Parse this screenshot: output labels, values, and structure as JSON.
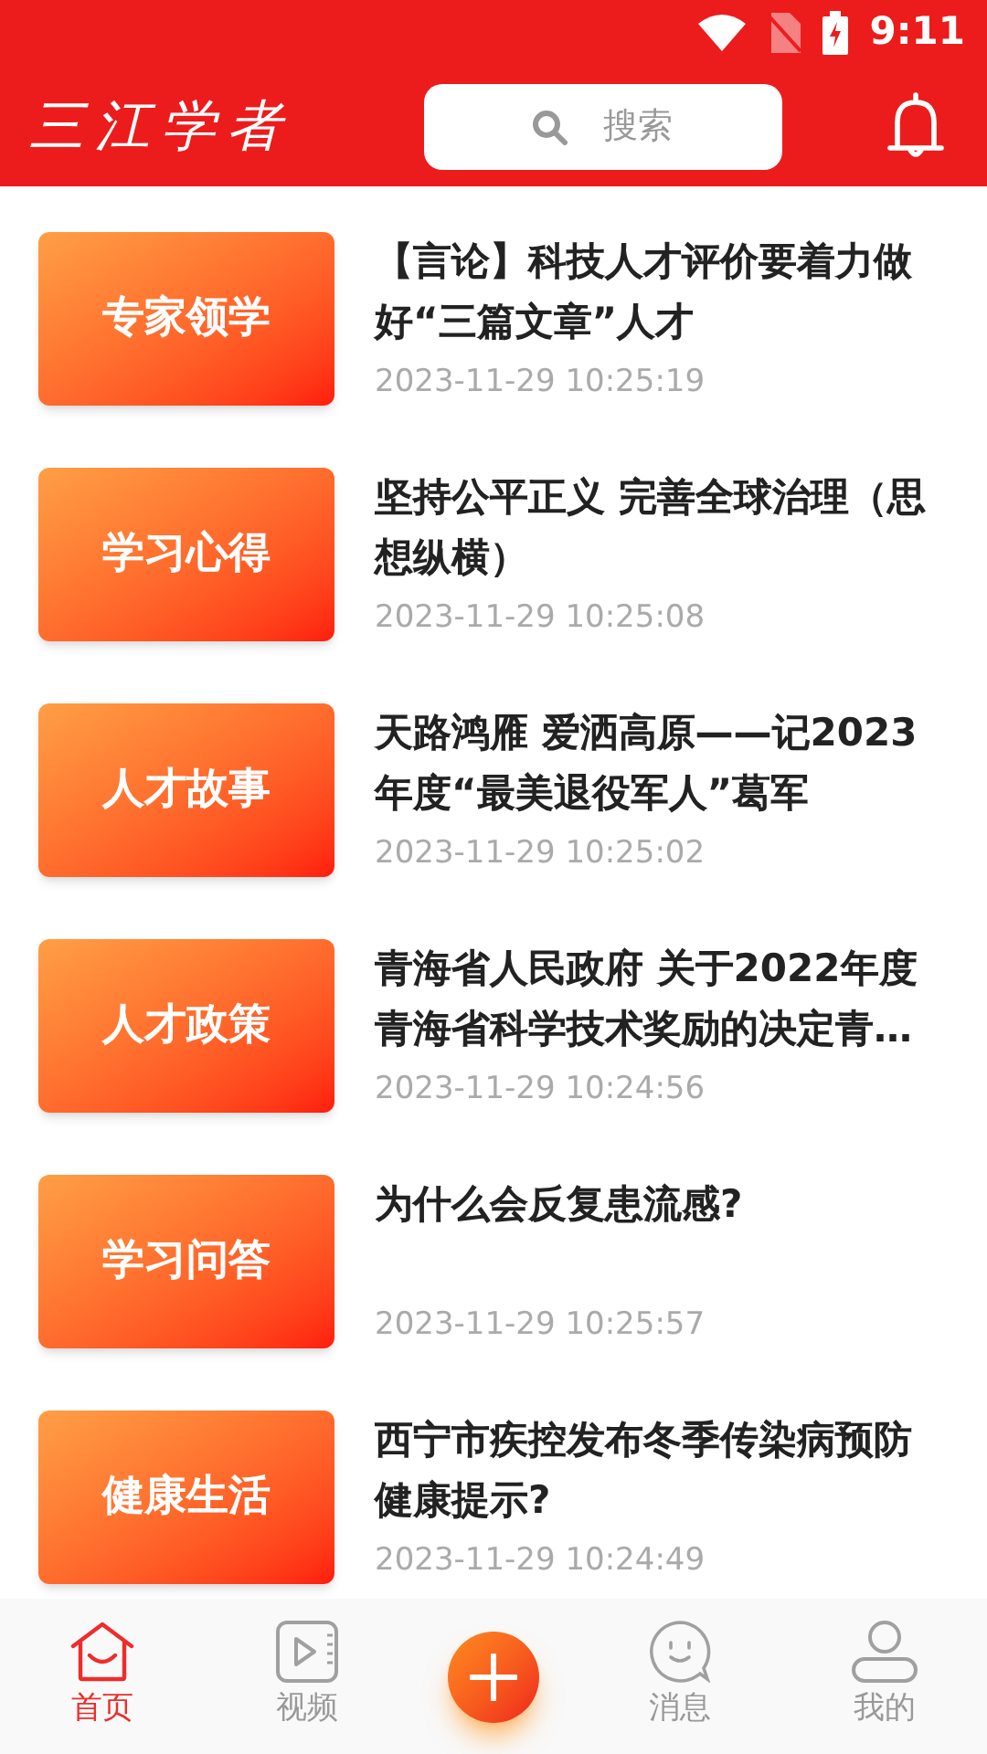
{
  "status_bar": {
    "time": "9:11"
  },
  "header": {
    "logo": "三江学者",
    "search": {
      "placeholder": "搜索"
    }
  },
  "articles": [
    {
      "category": "专家领学",
      "title": "【言论】科技人才评价要着力做好“三篇文章”人才",
      "time": "2023-11-29 10:25:19"
    },
    {
      "category": "学习心得",
      "title": "坚持公平正义 完善全球治理（思想纵横）",
      "time": "2023-11-29 10:25:08"
    },
    {
      "category": "人才故事",
      "title": "天路鸿雁 爱洒高原——记2023年度“最美退役军人”葛军",
      "time": "2023-11-29 10:25:02"
    },
    {
      "category": "人才政策",
      "title": "青海省人民政府 关于2022年度青海省科学技术奖励的决定青…",
      "time": "2023-11-29 10:24:56"
    },
    {
      "category": "学习问答",
      "title": "为什么会反复患流感?",
      "time": "2023-11-29 10:25:57"
    },
    {
      "category": "健康生活",
      "title": "西宁市疾控发布冬季传染病预防健康提示?",
      "time": "2023-11-29 10:24:49"
    }
  ],
  "nav": [
    {
      "kind": "home",
      "label": "首页",
      "selected": true
    },
    {
      "kind": "video",
      "label": "视频",
      "selected": false
    },
    {
      "kind": "add"
    },
    {
      "kind": "message",
      "label": "消息",
      "selected": false
    },
    {
      "kind": "profile",
      "label": "我的",
      "selected": false
    }
  ]
}
